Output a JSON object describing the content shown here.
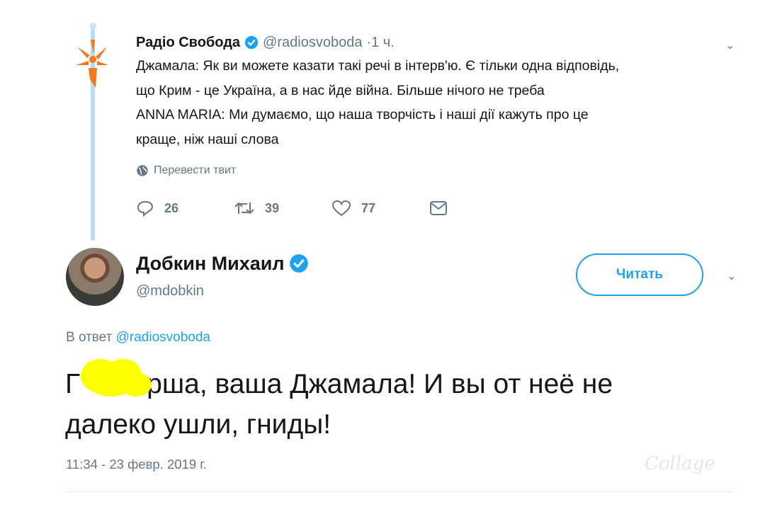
{
  "quoted_tweet": {
    "author_name": "Радіо Свобода",
    "handle": "@radiosvoboda",
    "time": "·1 ч.",
    "text_lines": [
      "Джамала: Як ви можете казати такі речі в інтерв'ю. Є тільки одна відповідь,",
      "що Крим - це Україна, а в нас йде війна. Більше нічого не треба",
      "ANNA MARIA: Ми думаємо, що наша творчість і наші дії кажуть про це",
      "краще, ніж наші слова"
    ],
    "translate_label": "Перевести твит",
    "replies": "26",
    "retweets": "39",
    "likes": "77",
    "icons": [
      "globe-icon",
      "reply-icon",
      "retweet-icon",
      "like-icon",
      "message-icon",
      "chevron-down-icon"
    ]
  },
  "reply_tweet": {
    "author_name": "Добкин Михаил",
    "handle": "@mdobkin",
    "follow_label": "Читать",
    "reply_prefix": "В ответ",
    "reply_handle": "@radiosvoboda",
    "text_line1_start": "Г",
    "text_line1_end": "рша, ваша Джамала! И вы от неё не",
    "text_line2": "далеко ушли, гниды!",
    "timestamp": "11:34 - 23 февр. 2019 г."
  },
  "watermark": "Collage",
  "colors": {
    "accent": "#1da1f2",
    "verified": "#1da1f2",
    "secondary_text": "#657786",
    "thread_line": "#b9dcf2",
    "redaction": "#ffff00",
    "logo_orange": "#f07b1e"
  }
}
